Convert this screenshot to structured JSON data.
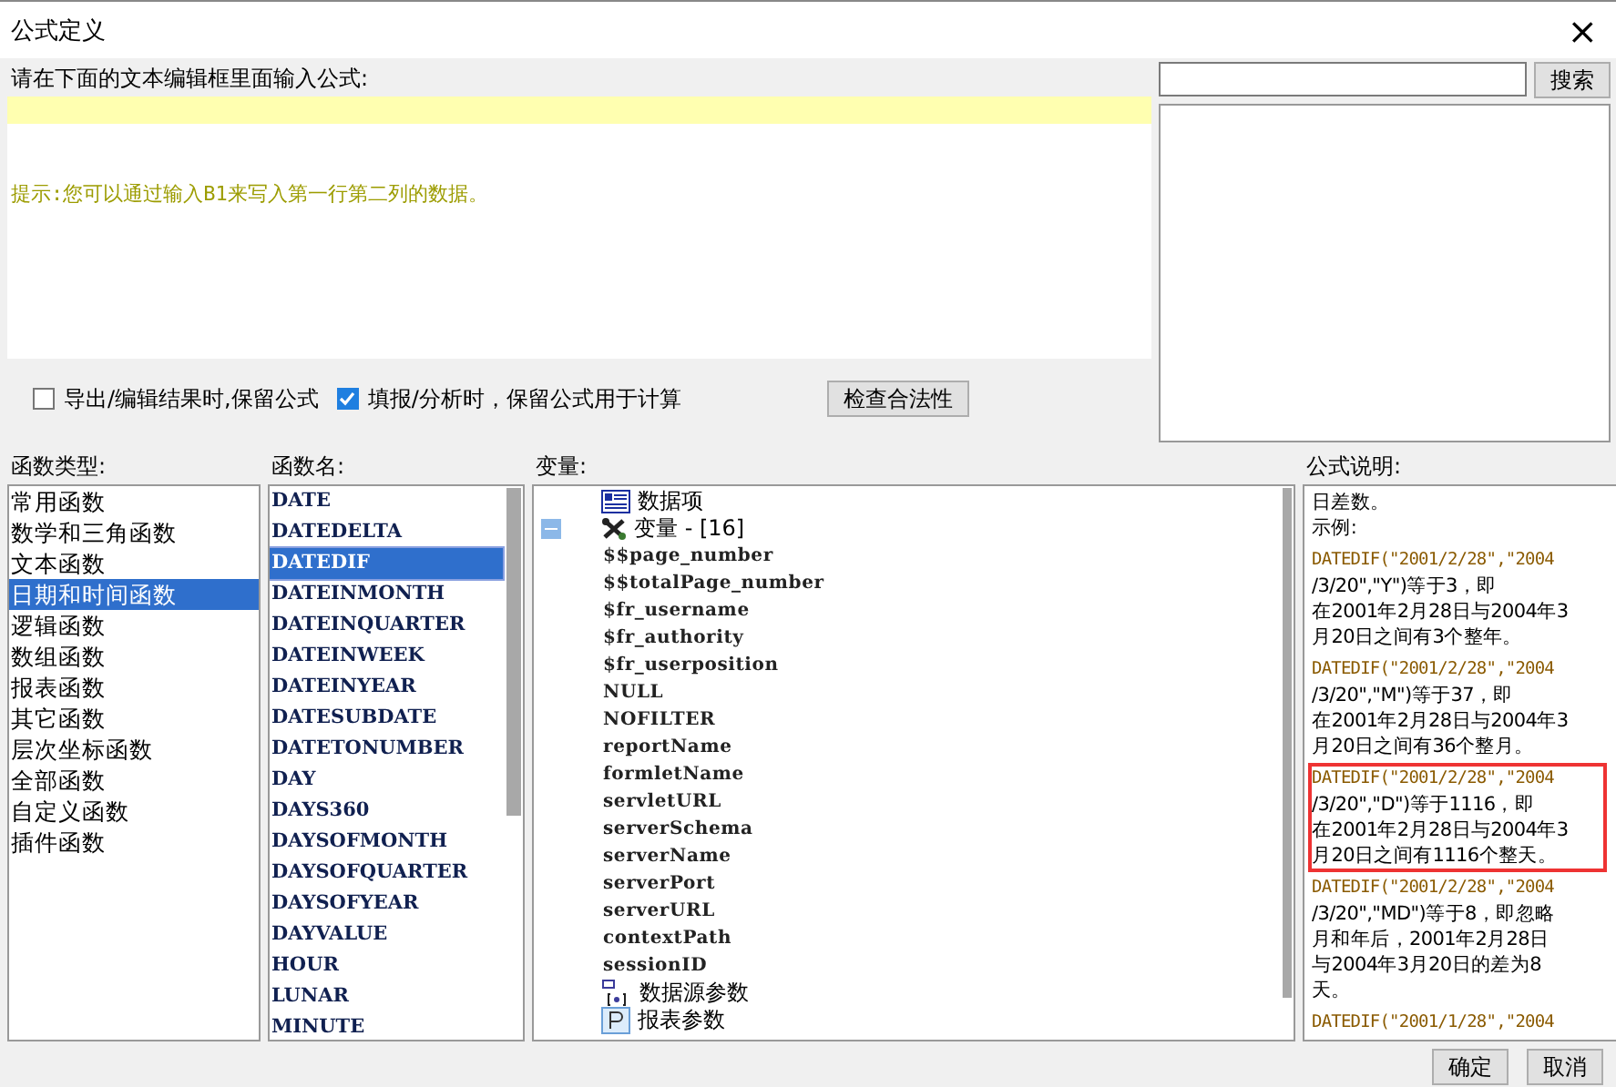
{
  "window": {
    "title": "公式定义",
    "close": "×"
  },
  "editor": {
    "label": "请在下面的文本编辑框里面输入公式:",
    "hint": "提示:您可以通过输入B1来写入第一行第二列的数据。"
  },
  "options": [
    {
      "label": "导出/编辑结果时,保留公式",
      "checked": false
    },
    {
      "label": "填报/分析时，保留公式用于计算",
      "checked": true
    }
  ],
  "check_button": "检查合法性",
  "search": {
    "button": "搜索"
  },
  "categories": {
    "label": "函数类型:",
    "items": [
      {
        "label": "常用函数",
        "selected": false
      },
      {
        "label": "数学和三角函数",
        "selected": false
      },
      {
        "label": "文本函数",
        "selected": false
      },
      {
        "label": "日期和时间函数",
        "selected": true
      },
      {
        "label": "逻辑函数",
        "selected": false
      },
      {
        "label": "数组函数",
        "selected": false
      },
      {
        "label": "报表函数",
        "selected": false
      },
      {
        "label": "其它函数",
        "selected": false
      },
      {
        "label": "层次坐标函数",
        "selected": false
      },
      {
        "label": "全部函数",
        "selected": false
      },
      {
        "label": "自定义函数",
        "selected": false
      },
      {
        "label": "插件函数",
        "selected": false
      }
    ]
  },
  "functions": {
    "label": "函数名:",
    "items": [
      {
        "label": "DATE",
        "selected": false
      },
      {
        "label": "DATEDELTA",
        "selected": false
      },
      {
        "label": "DATEDIF",
        "selected": true
      },
      {
        "label": "DATEINMONTH",
        "selected": false
      },
      {
        "label": "DATEINQUARTER",
        "selected": false
      },
      {
        "label": "DATEINWEEK",
        "selected": false
      },
      {
        "label": "DATEINYEAR",
        "selected": false
      },
      {
        "label": "DATESUBDATE",
        "selected": false
      },
      {
        "label": "DATETONUMBER",
        "selected": false
      },
      {
        "label": "DAY",
        "selected": false
      },
      {
        "label": "DAYS360",
        "selected": false
      },
      {
        "label": "DAYSOFMONTH",
        "selected": false
      },
      {
        "label": "DAYSOFQUARTER",
        "selected": false
      },
      {
        "label": "DAYSOFYEAR",
        "selected": false
      },
      {
        "label": "DAYVALUE",
        "selected": false
      },
      {
        "label": "HOUR",
        "selected": false
      },
      {
        "label": "LUNAR",
        "selected": false
      },
      {
        "label": "MINUTE",
        "selected": false
      }
    ]
  },
  "variables": {
    "label": "变量:",
    "tree": [
      {
        "label": "数据项",
        "kind": "data-item"
      },
      {
        "label": "变量 - [16]",
        "kind": "variable",
        "expanded": true,
        "children": [
          {
            "label": "$$page_number"
          },
          {
            "label": "$$totalPage_number"
          },
          {
            "label": "$fr_username"
          },
          {
            "label": "$fr_authority"
          },
          {
            "label": "$fr_userposition"
          },
          {
            "label": "NULL"
          },
          {
            "label": "NOFILTER"
          },
          {
            "label": "reportName"
          },
          {
            "label": "formletName"
          },
          {
            "label": "servletURL"
          },
          {
            "label": "serverSchema"
          },
          {
            "label": "serverName"
          },
          {
            "label": "serverPort"
          },
          {
            "label": "serverURL"
          },
          {
            "label": "contextPath"
          },
          {
            "label": "sessionID"
          }
        ]
      },
      {
        "label": "数据源参数",
        "kind": "datasource-param"
      },
      {
        "label": "报表参数",
        "kind": "report-param"
      }
    ]
  },
  "description": {
    "label": "公式说明:",
    "blocks": [
      {
        "highlighted": false,
        "lines": [
          "日差数。",
          "示例:"
        ]
      },
      {
        "highlighted": false,
        "lines": [
          "DATEDIF(\"2001/2/28\",\"2004",
          "/3/20\",\"Y\")等于3，即",
          "在2001年2月28日与2004年3",
          "月20日之间有3个整年。"
        ]
      },
      {
        "highlighted": false,
        "lines": [
          "DATEDIF(\"2001/2/28\",\"2004",
          "/3/20\",\"M\")等于37，即",
          "在2001年2月28日与2004年3",
          "月20日之间有36个整月。"
        ]
      },
      {
        "highlighted": true,
        "lines": [
          "DATEDIF(\"2001/2/28\",\"2004",
          "/3/20\",\"D\")等于1116，即",
          "在2001年2月28日与2004年3",
          "月20日之间有1116个整天。"
        ]
      },
      {
        "highlighted": false,
        "lines": [
          "DATEDIF(\"2001/2/28\",\"2004",
          "/3/20\",\"MD\")等于8，即忽略",
          "月和年后，2001年2月28日",
          "与2004年3月20日的差为8",
          "天。"
        ]
      },
      {
        "highlighted": false,
        "lines": [
          "DATEDIF(\"2001/1/28\",\"2004"
        ]
      }
    ]
  },
  "buttons": [
    "确定",
    "取消"
  ]
}
